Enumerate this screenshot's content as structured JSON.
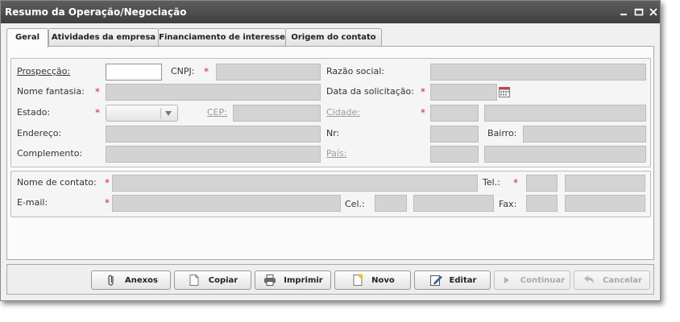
{
  "window": {
    "title": "Resumo da Operação/Negociação"
  },
  "tabs": [
    {
      "label": "Geral"
    },
    {
      "label": "Atividades da empresa"
    },
    {
      "label": "Financiamento de interesse"
    },
    {
      "label": "Origem do contato"
    }
  ],
  "company": {
    "prospeccao": "Prospecção:",
    "cnpj": "CNPJ:",
    "razao_social": "Razão social:",
    "nome_fantasia": "Nome fantasia:",
    "data_solicitacao": "Data da solicitação:",
    "estado": "Estado:",
    "cep": "CEP:",
    "cidade": "Cidade:",
    "endereco": "Endereço:",
    "nr": "Nr:",
    "bairro": "Bairro:",
    "complemento": "Complemento:",
    "pais": "País:"
  },
  "contact": {
    "nome_contato": "Nome de contato:",
    "tel": "Tel.:",
    "email": "E-mail:",
    "cel": "Cel.:",
    "fax": "Fax:"
  },
  "required_mark": "*",
  "buttons": [
    {
      "label": "Anexos",
      "icon": "paperclip-icon",
      "enabled": true
    },
    {
      "label": "Copiar",
      "icon": "copy-icon",
      "enabled": true
    },
    {
      "label": "Imprimir",
      "icon": "printer-icon",
      "enabled": true
    },
    {
      "label": "Novo",
      "icon": "new-document-icon",
      "enabled": true
    },
    {
      "label": "Editar",
      "icon": "edit-icon",
      "enabled": true
    },
    {
      "label": "Continuar",
      "icon": "play-icon",
      "enabled": false
    },
    {
      "label": "Cancelar",
      "icon": "undo-icon",
      "enabled": false
    }
  ],
  "colors": {
    "titlebar": "#4a4a4a",
    "required": "#d22222",
    "field_disabled": "#d3d3d3"
  }
}
